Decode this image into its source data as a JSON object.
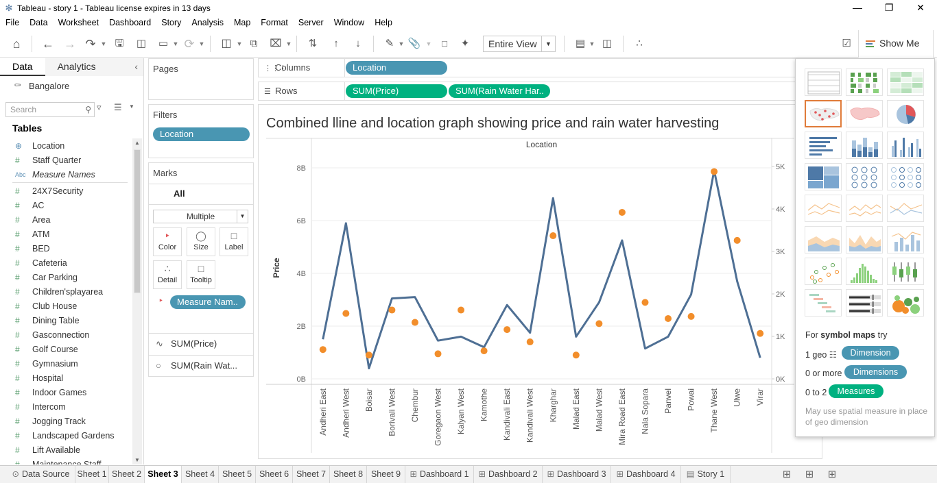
{
  "window": {
    "title": "Tableau - story 1 - Tableau license expires in 13 days"
  },
  "menu": [
    "File",
    "Data",
    "Worksheet",
    "Dashboard",
    "Story",
    "Analysis",
    "Map",
    "Format",
    "Server",
    "Window",
    "Help"
  ],
  "toolbar": {
    "fit_label": "Entire View",
    "show_me_label": "Show Me"
  },
  "data_pane": {
    "tabs": {
      "data": "Data",
      "analytics": "Analytics"
    },
    "datasource": "Bangalore",
    "search_placeholder": "Search",
    "tables_heading": "Tables",
    "fields": [
      {
        "name": "Location",
        "icon": "globe-icon"
      },
      {
        "name": "Staff Quarter",
        "icon": "hash-icon"
      },
      {
        "name": "Measure Names",
        "icon": "abc-icon"
      },
      {
        "name": "24X7Security",
        "icon": "hash-icon"
      },
      {
        "name": "AC",
        "icon": "hash-icon"
      },
      {
        "name": "Area",
        "icon": "hash-icon"
      },
      {
        "name": "ATM",
        "icon": "hash-icon"
      },
      {
        "name": "BED",
        "icon": "hash-icon"
      },
      {
        "name": "Cafeteria",
        "icon": "hash-icon"
      },
      {
        "name": "Car Parking",
        "icon": "hash-icon"
      },
      {
        "name": "Children'splayarea",
        "icon": "hash-icon"
      },
      {
        "name": "Club House",
        "icon": "hash-icon"
      },
      {
        "name": "Dining Table",
        "icon": "hash-icon"
      },
      {
        "name": "Gasconnection",
        "icon": "hash-icon"
      },
      {
        "name": "Golf Course",
        "icon": "hash-icon"
      },
      {
        "name": "Gymnasium",
        "icon": "hash-icon"
      },
      {
        "name": "Hospital",
        "icon": "hash-icon"
      },
      {
        "name": "Indoor Games",
        "icon": "hash-icon"
      },
      {
        "name": "Intercom",
        "icon": "hash-icon"
      },
      {
        "name": "Jogging Track",
        "icon": "hash-icon"
      },
      {
        "name": "Landscaped Gardens",
        "icon": "hash-icon"
      },
      {
        "name": "Lift Available",
        "icon": "hash-icon"
      },
      {
        "name": "Maintenance Staff",
        "icon": "hash-icon"
      }
    ]
  },
  "cards": {
    "pages": "Pages",
    "filters": "Filters",
    "filter_pill": "Location",
    "marks": "Marks",
    "marks_all": "All",
    "mark_type": "Multiple",
    "mark_buttons": [
      "Color",
      "Size",
      "Label",
      "Detail",
      "Tooltip"
    ],
    "color_pill": "Measure Nam..",
    "measures": [
      "SUM(Price)",
      "SUM(Rain Wat..."
    ]
  },
  "shelves": {
    "columns_label": "Columns",
    "columns_pill": "Location",
    "rows_label": "Rows",
    "rows_pills": [
      "SUM(Price)",
      "SUM(Rain Water Har.."
    ]
  },
  "chart_data": {
    "type": "line",
    "title": "Combined lline and location graph showing price and rain water harvesting",
    "header": "Location",
    "ylabel": "Price",
    "categories": [
      "Andheri East",
      "Andheri West",
      "Boisar",
      "Borivali West",
      "Chembur",
      "Goregaon West",
      "Kalyan West",
      "Kamothe",
      "Kandivali East",
      "Kandivali West",
      "Kharghar",
      "Malad East",
      "Malad West",
      "Mira Road East",
      "Nala Sopara",
      "Panvel",
      "Powai",
      "Thane West",
      "Ulwe",
      "Virar"
    ],
    "series": [
      {
        "name": "SUM(Price)",
        "mark": "line",
        "axis": "left",
        "color": "#4e6f94",
        "values": [
          1.5,
          5.9,
          0.4,
          3.05,
          3.1,
          1.45,
          1.6,
          1.2,
          2.8,
          1.75,
          6.85,
          1.6,
          2.9,
          5.25,
          1.15,
          1.6,
          3.2,
          7.9,
          3.7,
          0.8
        ]
      },
      {
        "name": "SUM(Rain Water Harvesting)",
        "mark": "circle",
        "axis": "right",
        "color": "#f28e2b",
        "values": [
          690,
          1540,
          560,
          1620,
          1330,
          590,
          1620,
          660,
          1160,
          870,
          3370,
          560,
          1300,
          3920,
          1800,
          1420,
          1470,
          4880,
          3260,
          1070
        ]
      }
    ],
    "left_axis": {
      "ticks": [
        "0B",
        "2B",
        "4B",
        "6B",
        "8B"
      ],
      "ylim": [
        0,
        8
      ]
    },
    "right_axis": {
      "ticks": [
        "0K",
        "1K",
        "2K",
        "3K",
        "4K",
        "5K"
      ],
      "ylim": [
        0,
        5000
      ]
    }
  },
  "show_me": {
    "hint_prefix": "For",
    "hint_bold": "symbol maps",
    "hint_suffix": "try",
    "req1_label": "1 geo",
    "req1_pill": "Dimension",
    "req2_label": "0 or more",
    "req2_pill": "Dimensions",
    "req3_label": "0 to 2",
    "req3_pill": "Measures",
    "note": "May use spatial measure in place of geo dimension"
  },
  "sheet_tabs": [
    {
      "label": "Data Source",
      "kind": "datasource"
    },
    {
      "label": "Sheet 1",
      "kind": "sheet"
    },
    {
      "label": "Sheet 2",
      "kind": "sheet"
    },
    {
      "label": "Sheet 3",
      "kind": "sheet",
      "active": true
    },
    {
      "label": "Sheet 4",
      "kind": "sheet"
    },
    {
      "label": "Sheet 5",
      "kind": "sheet"
    },
    {
      "label": "Sheet 6",
      "kind": "sheet"
    },
    {
      "label": "Sheet 7",
      "kind": "sheet"
    },
    {
      "label": "Sheet 8",
      "kind": "sheet"
    },
    {
      "label": "Sheet 9",
      "kind": "sheet"
    },
    {
      "label": "Dashboard 1",
      "kind": "dashboard"
    },
    {
      "label": "Dashboard 2",
      "kind": "dashboard"
    },
    {
      "label": "Dashboard 3",
      "kind": "dashboard"
    },
    {
      "label": "Dashboard 4",
      "kind": "dashboard"
    },
    {
      "label": "Story 1",
      "kind": "story"
    }
  ]
}
